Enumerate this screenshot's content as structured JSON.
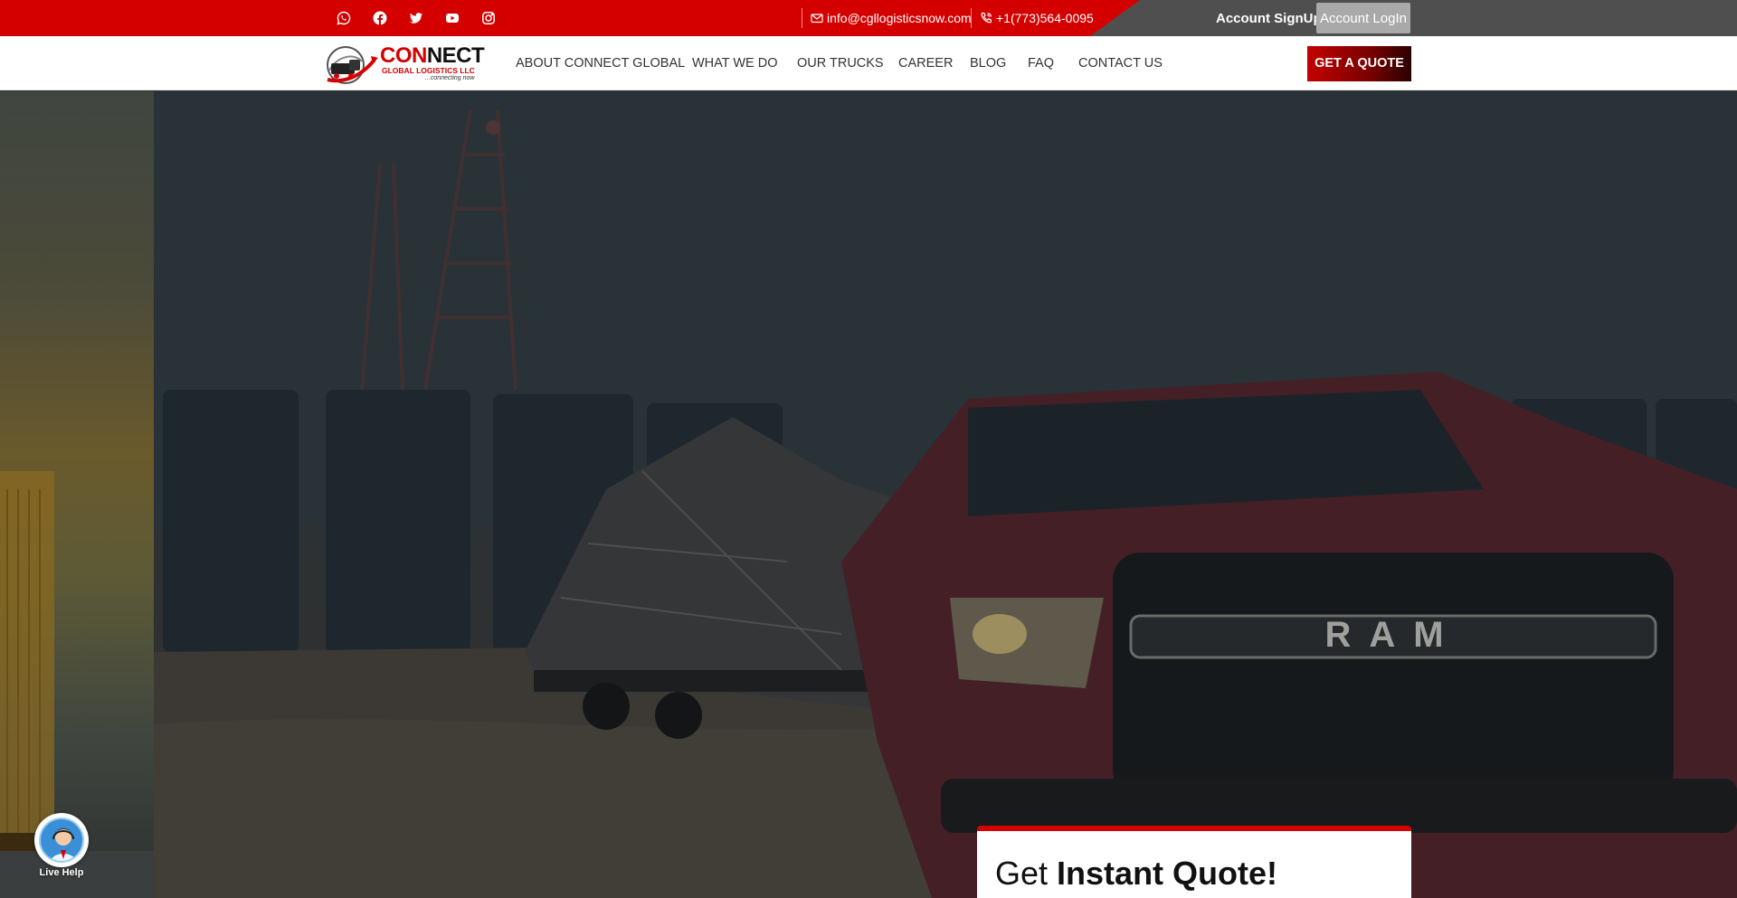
{
  "topbar": {
    "social_icons": [
      "whatsapp-icon",
      "facebook-icon",
      "twitter-icon",
      "youtube-icon",
      "instagram-icon"
    ],
    "email": "info@cgllogisticsnow.com",
    "phone": "+1(773)564-0095",
    "account_signup": "Account SignUp",
    "account_login": "Account LogIn"
  },
  "logo": {
    "name_con": "CON",
    "name_nect": "NECT",
    "subtitle": "GLOBAL LOGISTICS LLC",
    "tagline": "...connecting now"
  },
  "nav": {
    "items": [
      "ABOUT CONNECT GLOBAL",
      "WHAT WE DO",
      "OUR TRUCKS",
      "CAREER",
      "BLOG",
      "FAQ",
      "CONTACT US"
    ],
    "cta": "GET A QUOTE"
  },
  "hero": {
    "grille_text": "RAM"
  },
  "quote_card": {
    "title_light": "Get",
    "title_bold": "Instant Quote!"
  },
  "live_help": {
    "label": "Live Help"
  },
  "colors": {
    "brand_red": "#d40000",
    "topbar_dark": "#4f4f4f",
    "login_bg": "#a9a9a9"
  }
}
